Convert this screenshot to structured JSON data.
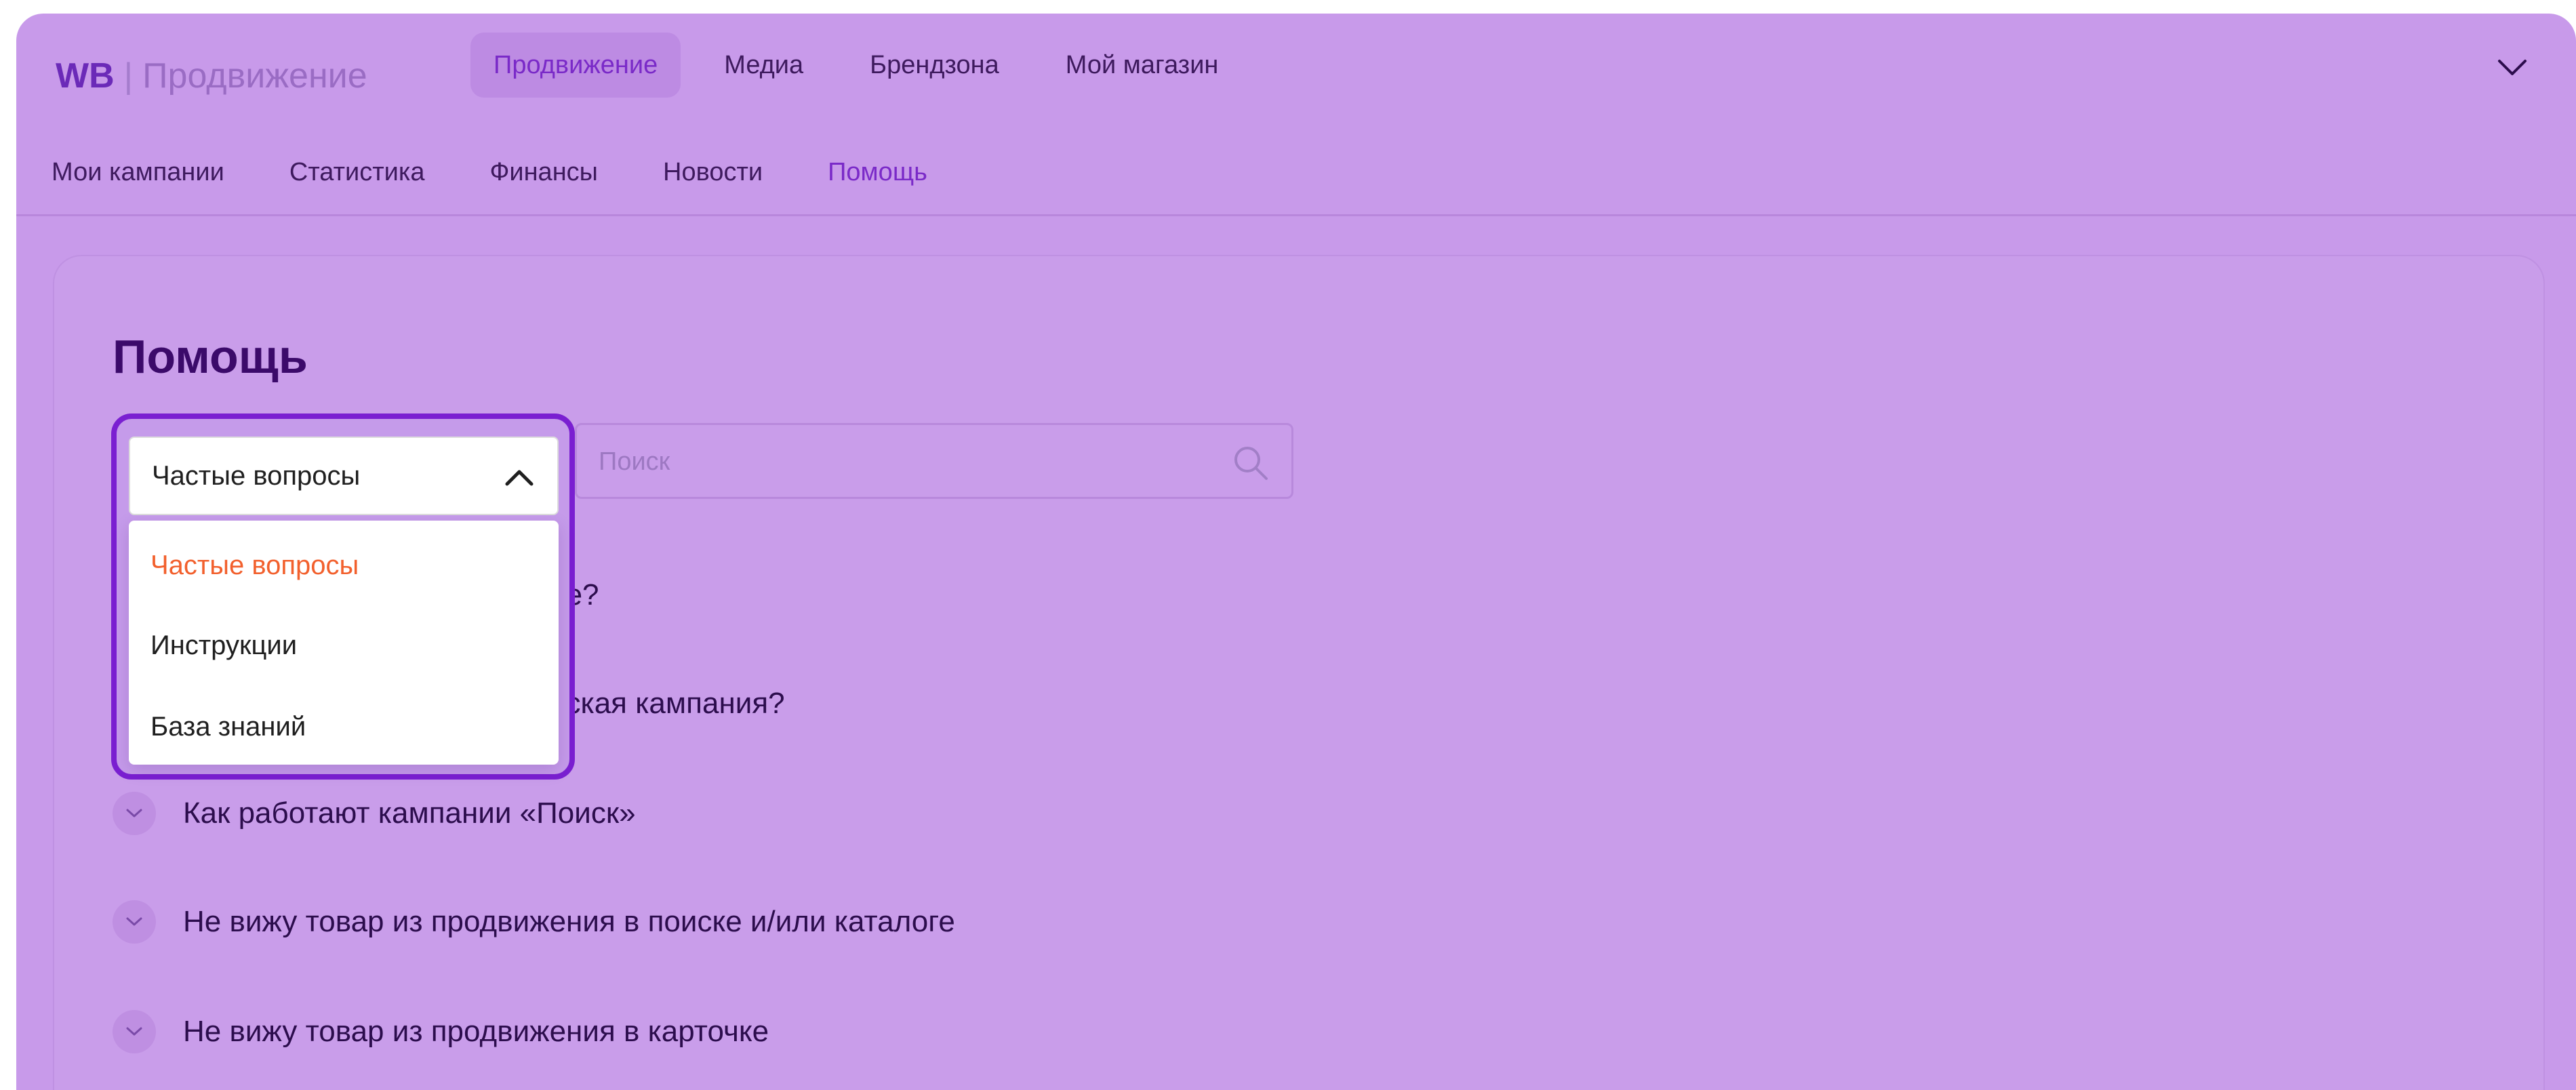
{
  "brand": {
    "logo": "WB",
    "separator": "|",
    "name": "Продвижение"
  },
  "top_nav": {
    "items": [
      {
        "label": "Продвижение",
        "active": true
      },
      {
        "label": "Медиа",
        "active": false
      },
      {
        "label": "Брендзона",
        "active": false
      },
      {
        "label": "Мой магазин",
        "active": false
      }
    ],
    "collapse_icon": "chevron-down-icon"
  },
  "sub_nav": {
    "items": [
      {
        "label": "Мои кампании",
        "active": false
      },
      {
        "label": "Статистика",
        "active": false
      },
      {
        "label": "Финансы",
        "active": false
      },
      {
        "label": "Новости",
        "active": false
      },
      {
        "label": "Помощь",
        "active": true
      }
    ]
  },
  "page": {
    "title": "Помощь"
  },
  "category_select": {
    "value": "Частые вопросы",
    "icon": "chevron-up-icon",
    "options": [
      {
        "label": "Частые вопросы",
        "selected": true
      },
      {
        "label": "Инструкции",
        "selected": false
      },
      {
        "label": "База знаний",
        "selected": false
      }
    ]
  },
  "search": {
    "placeholder": "Поиск",
    "icon": "search-icon"
  },
  "faq": {
    "items": [
      {
        "question": "ие?",
        "partially_hidden": true
      },
      {
        "question": "еская кампания?",
        "partially_hidden": true
      },
      {
        "question": "Как работают кампании «Поиск»",
        "partially_hidden": false
      },
      {
        "question": "Не вижу товар из продвижения в поиске и/или каталоге",
        "partially_hidden": false
      },
      {
        "question": "Не вижу товар из продвижения в карточке",
        "partially_hidden": false
      }
    ]
  },
  "colors": {
    "overlay": "#c89aea",
    "accent": "#7a2ac8",
    "highlight_outline": "#7a1fd1",
    "selected_option": "#f2602d",
    "heading": "#3b0a6a"
  }
}
